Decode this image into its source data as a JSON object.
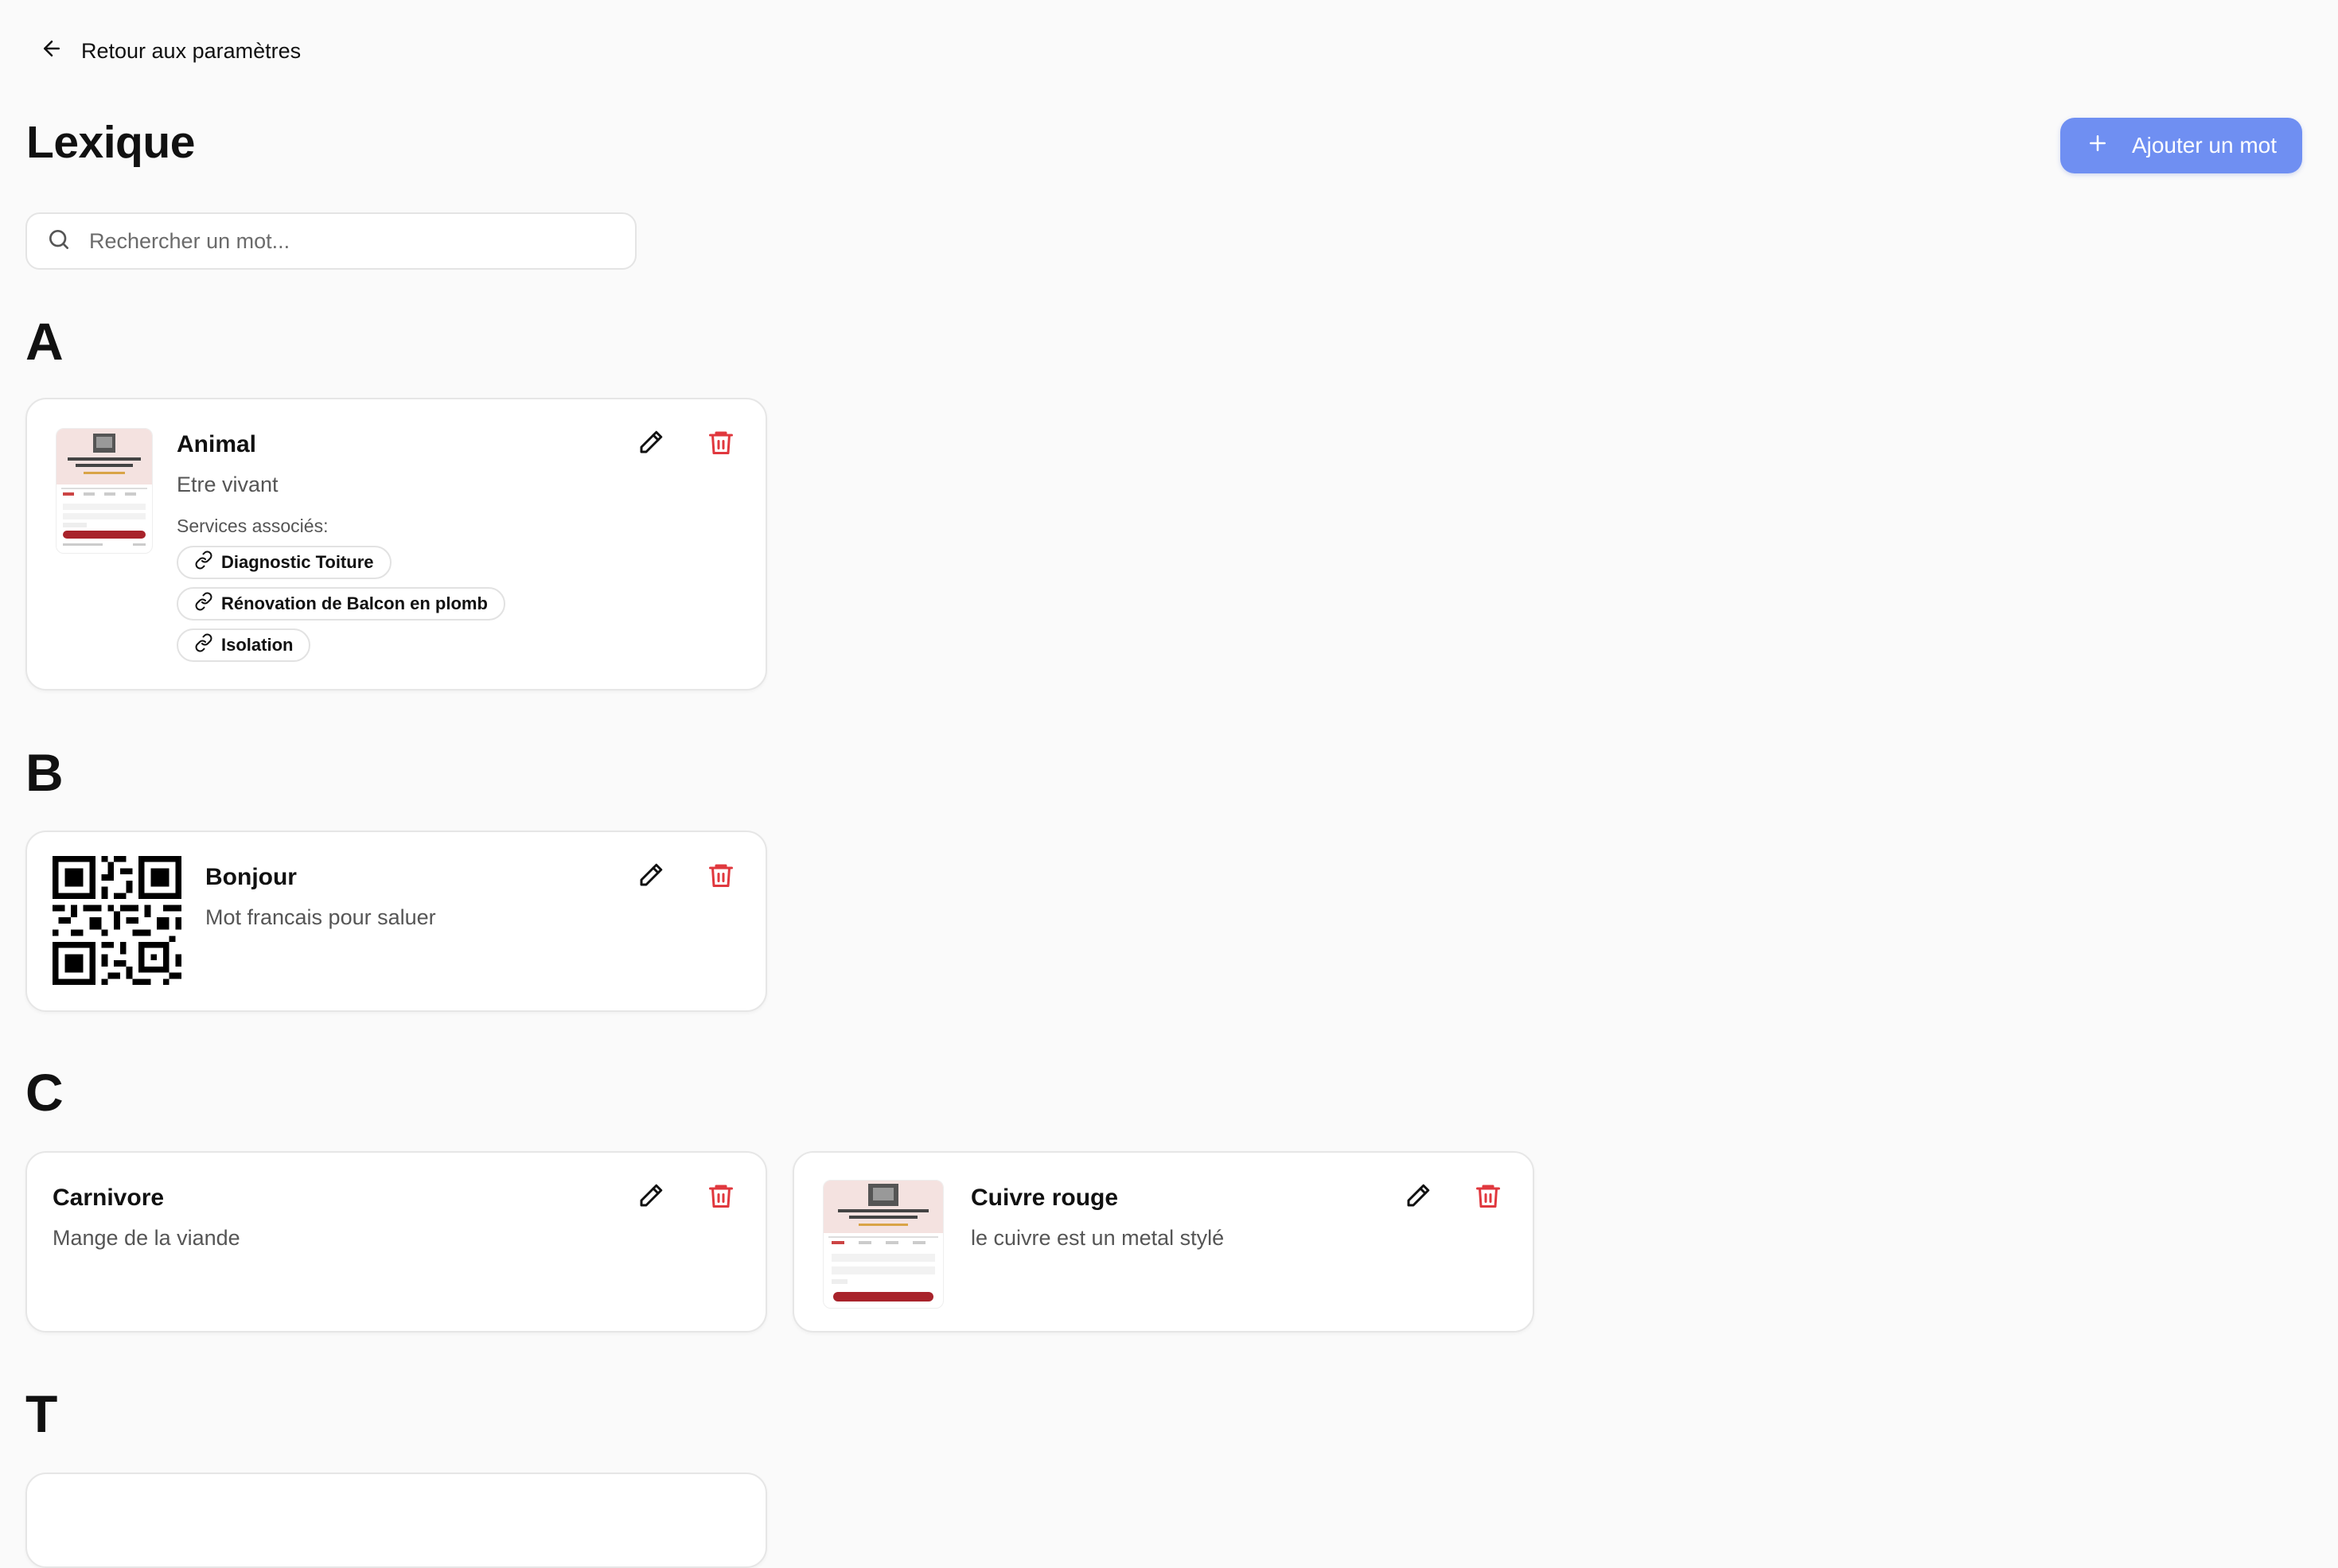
{
  "nav": {
    "back_label": "Retour aux paramètres"
  },
  "header": {
    "title": "Lexique",
    "add_button_label": "Ajouter un mot"
  },
  "search": {
    "placeholder": "Rechercher un mot..."
  },
  "sections": [
    {
      "letter": "A",
      "entries": [
        {
          "word": "Animal",
          "definition": "Etre vivant",
          "image": "form-screenshot-thumbnail",
          "services_label": "Services associés:",
          "services": [
            "Diagnostic Toiture",
            "Rénovation de Balcon en plomb",
            "Isolation"
          ]
        }
      ]
    },
    {
      "letter": "B",
      "entries": [
        {
          "word": "Bonjour",
          "definition": "Mot francais pour saluer",
          "image": "qr-code-image"
        }
      ]
    },
    {
      "letter": "C",
      "entries": [
        {
          "word": "Carnivore",
          "definition": "Mange de la viande"
        },
        {
          "word": "Cuivre rouge",
          "definition": "le cuivre est un metal stylé",
          "image": "form-screenshot-thumbnail"
        }
      ]
    },
    {
      "letter": "T",
      "entries": []
    }
  ],
  "icons": {
    "back": "arrow-left-icon",
    "add": "plus-icon",
    "search": "search-icon",
    "edit": "pencil-icon",
    "delete": "trash-icon",
    "service": "link-icon"
  },
  "colors": {
    "primary": "#6f8ff2",
    "danger": "#e0383e",
    "background": "#fafafa",
    "card": "#ffffff"
  }
}
